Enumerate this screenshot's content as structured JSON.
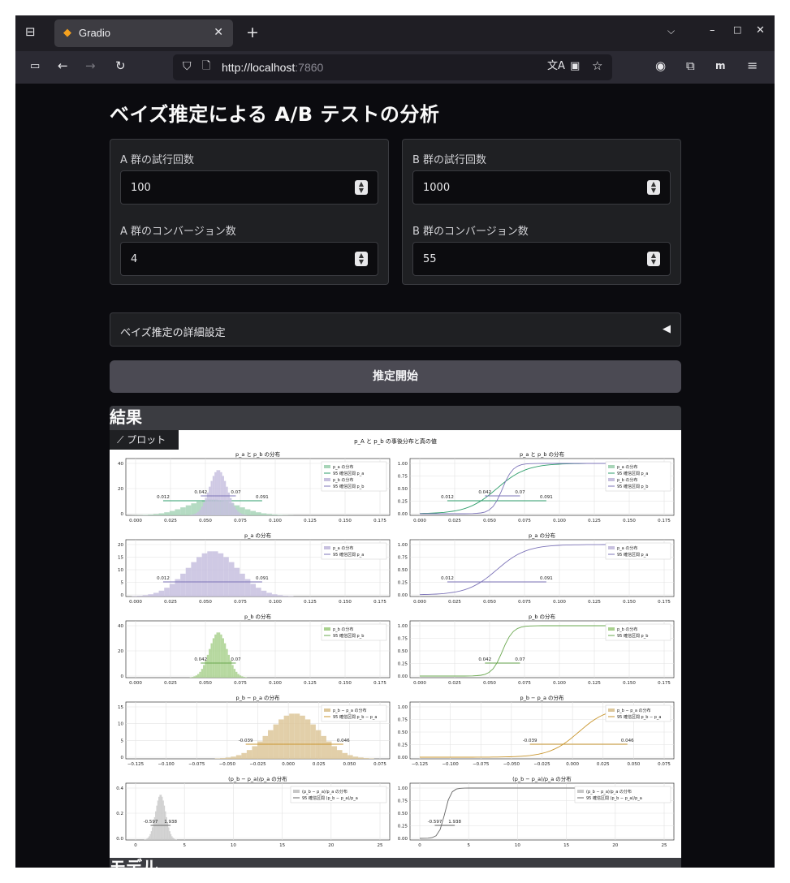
{
  "browser": {
    "tab_title": "Gradio",
    "url_host": "http://localhost",
    "url_port": ":7860"
  },
  "app": {
    "title": "ベイズ推定による A/B テストの分析",
    "group_a": {
      "trials_label": "A 群の試行回数",
      "trials_value": "100",
      "conv_label": "A 群のコンバージョン数",
      "conv_value": "4"
    },
    "group_b": {
      "trials_label": "B 群の試行回数",
      "trials_value": "1000",
      "conv_label": "B 群のコンバージョン数",
      "conv_value": "55"
    },
    "accordion_label": "ベイズ推定の詳細設定",
    "run_button": "推定開始",
    "results_heading": "結果",
    "plot_label": "プロット",
    "model_heading": "モデル"
  },
  "chart_data": {
    "type": "histogram+cdf grid",
    "suptitle": "p_A と p_b の事後分布と真の値",
    "rows": [
      {
        "title": "p_a と p_b の分布",
        "legend_left": [
          "p_a の分布",
          "95 確信区間 p_a",
          "p_b の分布",
          "95 確信区間 p_b"
        ],
        "legend_right": [
          "p_a の分布",
          "95 確信区間 p_a",
          "p_b の分布",
          "95 確信区間 p_b"
        ],
        "interval_a": [
          0.012,
          0.091
        ],
        "interval_b": [
          0.042,
          0.07
        ],
        "xticks": [
          "0.000",
          "0.025",
          "0.050",
          "0.075",
          "0.100",
          "0.125",
          "0.150",
          "0.175"
        ],
        "yticks_left": [
          "0",
          "20",
          "40"
        ]
      },
      {
        "title": "p_a の分布",
        "legend": [
          "p_a の分布",
          "95 確信区間 p_a"
        ],
        "interval": [
          0.012,
          0.091
        ],
        "xticks": [
          "0.000",
          "0.025",
          "0.050",
          "0.075",
          "0.100",
          "0.125",
          "0.150",
          "0.175"
        ],
        "yticks_left": [
          "0",
          "5",
          "10",
          "15",
          "20"
        ]
      },
      {
        "title": "p_b の分布",
        "legend": [
          "p_b の分布",
          "95 確信区間 p_b"
        ],
        "interval": [
          0.042,
          0.07
        ],
        "xticks": [
          "0.000",
          "0.025",
          "0.050",
          "0.075",
          "0.100",
          "0.125",
          "0.150",
          "0.175"
        ],
        "yticks_left": [
          "0",
          "20",
          "40"
        ]
      },
      {
        "title": "p_b − p_a の分布",
        "legend": [
          "p_b − p_a の分布",
          "95 確信区間 p_b − p_a"
        ],
        "interval": [
          -0.039,
          0.046
        ],
        "xticks": [
          "−0.125",
          "−0.100",
          "−0.075",
          "−0.050",
          "−0.025",
          "0.000",
          "0.025",
          "0.050",
          "0.075"
        ],
        "yticks_left": [
          "0",
          "5",
          "10",
          "15"
        ]
      },
      {
        "title": "(p_b − p_a)/p_a の分布",
        "legend": [
          "(p_b − p_a)/p_a の分布",
          "95 確信区間 (p_b − p_a)/p_a"
        ],
        "interval": [
          -0.597,
          1.938
        ],
        "xticks": [
          "0",
          "5",
          "10",
          "15",
          "20",
          "25"
        ],
        "yticks_left": [
          "0.0",
          "0.2",
          "0.4"
        ]
      }
    ],
    "yticks_right": [
      "0.00",
      "0.25",
      "0.50",
      "0.75",
      "1.00"
    ],
    "colors": {
      "a": "#a8d5b8",
      "a_line": "#2e9e6b",
      "b": "#c7c0df",
      "b_line": "#7e75b9",
      "b_only": "#a9d18e",
      "b_only_line": "#6aa84f",
      "diff": "#ddc79a",
      "diff_line": "#c9962e",
      "ratio": "#c8c8c8",
      "ratio_line": "#666666"
    }
  }
}
